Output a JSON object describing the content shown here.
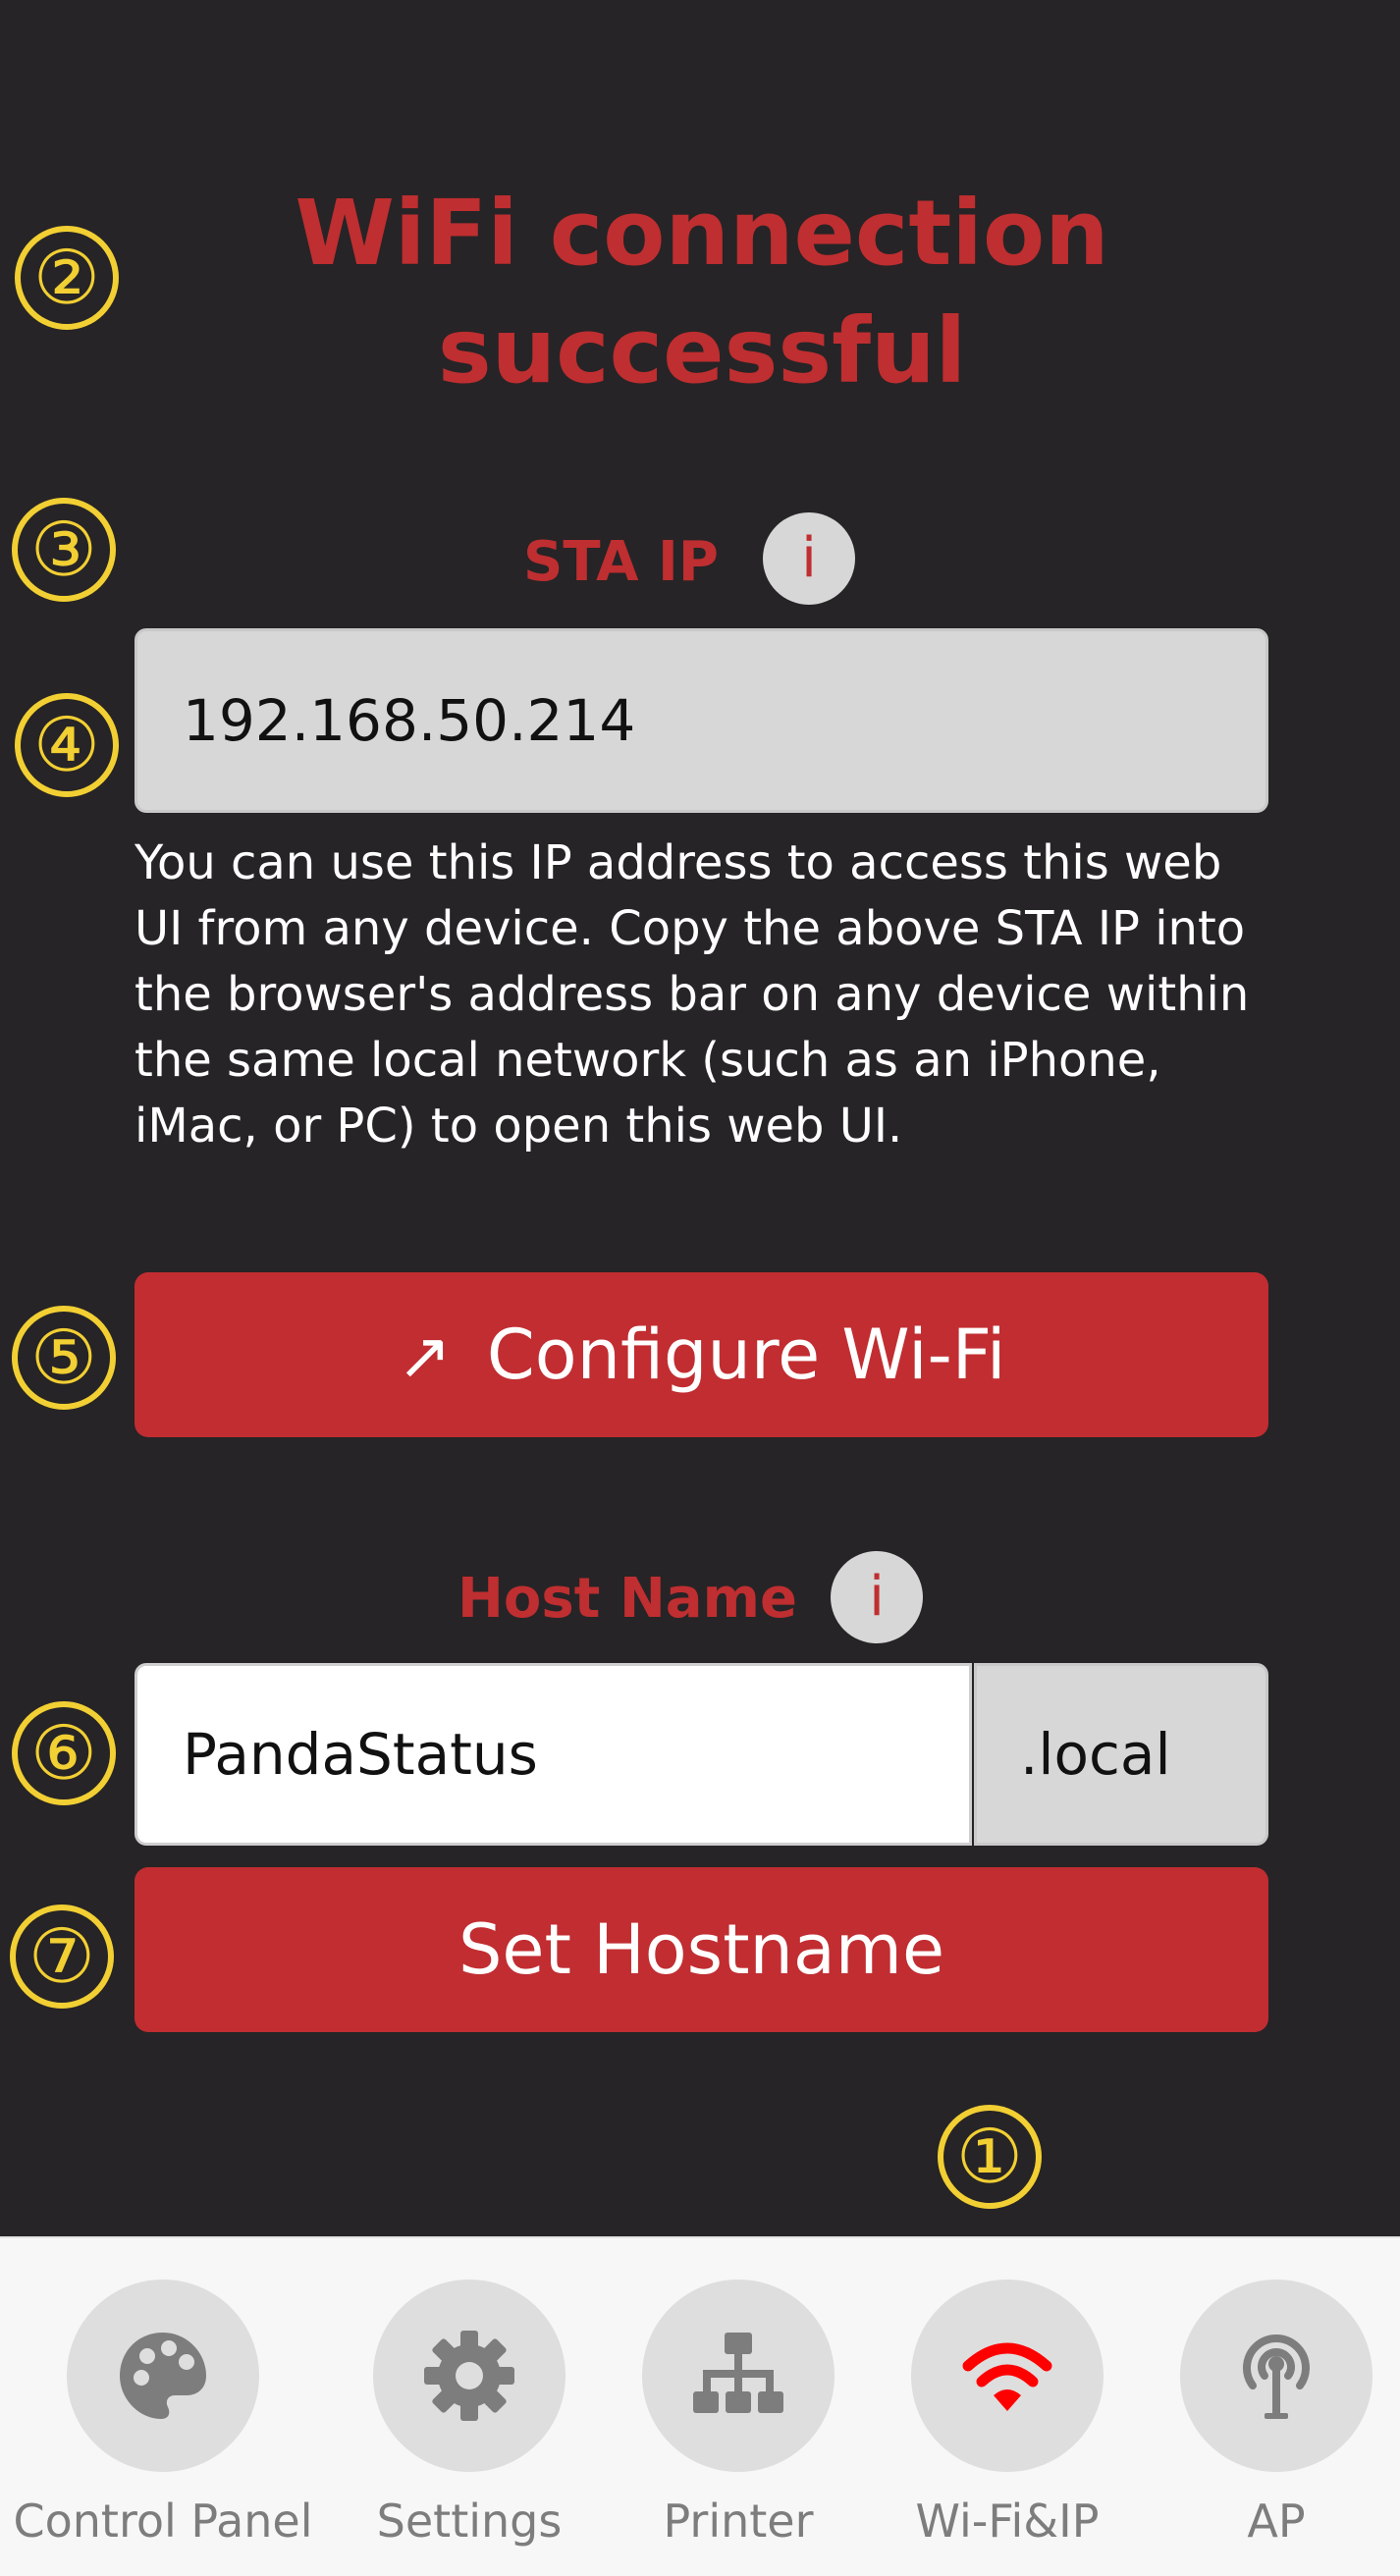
{
  "markers": {
    "m1": "①",
    "m2": "②",
    "m3": "③",
    "m4": "④",
    "m5": "⑤",
    "m6": "⑥",
    "m7": "⑦"
  },
  "status": {
    "title_line1": "WiFi connection",
    "title_line2": "successful"
  },
  "sta_ip": {
    "label": "STA IP",
    "info_glyph": "i",
    "value": "192.168.50.214",
    "description": "You can use this IP address to access this web UI from any device. Copy the above STA IP into the browser's address bar on any device within the same local network (such as an iPhone, iMac, or PC) to open this web UI."
  },
  "configure_wifi": {
    "arrow": "↗",
    "label": "Configure Wi-Fi"
  },
  "hostname": {
    "label": "Host Name",
    "info_glyph": "i",
    "value": "PandaStatus",
    "suffix": ".local",
    "set_label": "Set Hostname"
  },
  "nav": {
    "items": [
      {
        "label": "Control Panel",
        "icon": "palette-icon",
        "active": false
      },
      {
        "label": "Settings",
        "icon": "gear-icon",
        "active": false
      },
      {
        "label": "Printer",
        "icon": "network-tree-icon",
        "active": false
      },
      {
        "label": "Wi-Fi&IP",
        "icon": "wifi-icon",
        "active": true
      },
      {
        "label": "AP",
        "icon": "antenna-icon",
        "active": false
      }
    ]
  },
  "colors": {
    "background": "#262426",
    "accent_red": "#c12d31",
    "marker_yellow": "#f2cf33",
    "icon_gray": "#7d7d7d",
    "wifi_active": "#ff0000"
  }
}
